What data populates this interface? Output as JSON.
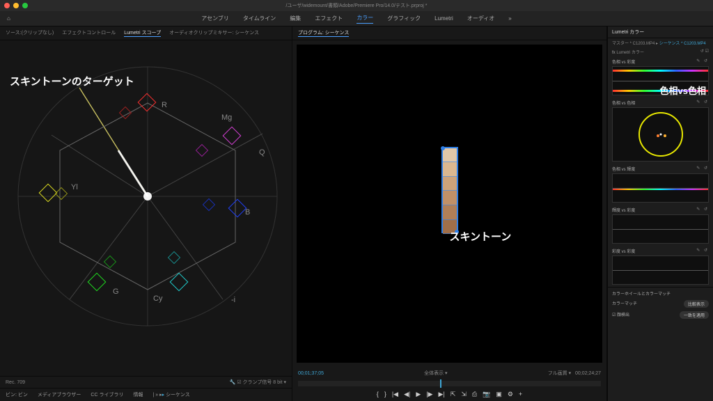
{
  "window": {
    "title": "/ユーザ/widemount/書類/Adobe/Premiere Pro/14.0/テスト.prproj *"
  },
  "workspaces": [
    "アセンブリ",
    "タイムライン",
    "編集",
    "エフェクト",
    "カラー",
    "グラフィック",
    "Lumetri",
    "オーディオ"
  ],
  "activeWorkspace": "カラー",
  "leftTabs": [
    "ソース:(クリップなし)",
    "エフェクトコントロール",
    "Lumetri スコープ",
    "オーディオクリップミキサー: シーケンス"
  ],
  "activeLeftTab": "Lumetri スコープ",
  "vectorscope": {
    "labels": {
      "R": "R",
      "Mg": "Mg",
      "Q": "Q",
      "B": "B",
      "i": "-i",
      "Cy": "Cy",
      "G": "G",
      "Yl": "Yl"
    }
  },
  "leftStatus": {
    "rec": "Rec. 709",
    "clamp": "クランプ信号",
    "bit": "8 bit"
  },
  "bottomTabs": [
    "ビン: ビン",
    "メディアブラウザー",
    "CC ライブラリ",
    "情報",
    "シーケンス"
  ],
  "program": {
    "title": "プログラム: シーケンス",
    "tc_in": "00;01;37;05",
    "fit": "全体表示",
    "full": "フル画質",
    "tc_out": "00;02;24;27"
  },
  "skinSwatches": [
    "#e0c7a8",
    "#dbb890",
    "#cda37a",
    "#c09068",
    "#b07f58",
    "#a06f4a"
  ],
  "lumetri": {
    "title": "Lumetri カラー",
    "master": "マスター * C1203.MP4",
    "seq": "シーケンス * C1203.MP4",
    "preset": "Lumetri カラー",
    "curves": [
      {
        "name": "色相 vs 彩度"
      },
      {
        "name": "色相 vs 色相",
        "wheel": true
      },
      {
        "name": "色相 vs 輝度"
      },
      {
        "name": "輝度 vs 彩度"
      },
      {
        "name": "彩度 vs 彩度"
      }
    ],
    "wheels": "カラーホイールとカラーマッチ",
    "match": "カラーマッチ",
    "compare": "比較表示",
    "face": "顔検出",
    "apply": "一致を適用"
  },
  "annotations": {
    "left": "スキントーンのターゲット",
    "center": "スキントーン",
    "right": "色相vs色相"
  }
}
